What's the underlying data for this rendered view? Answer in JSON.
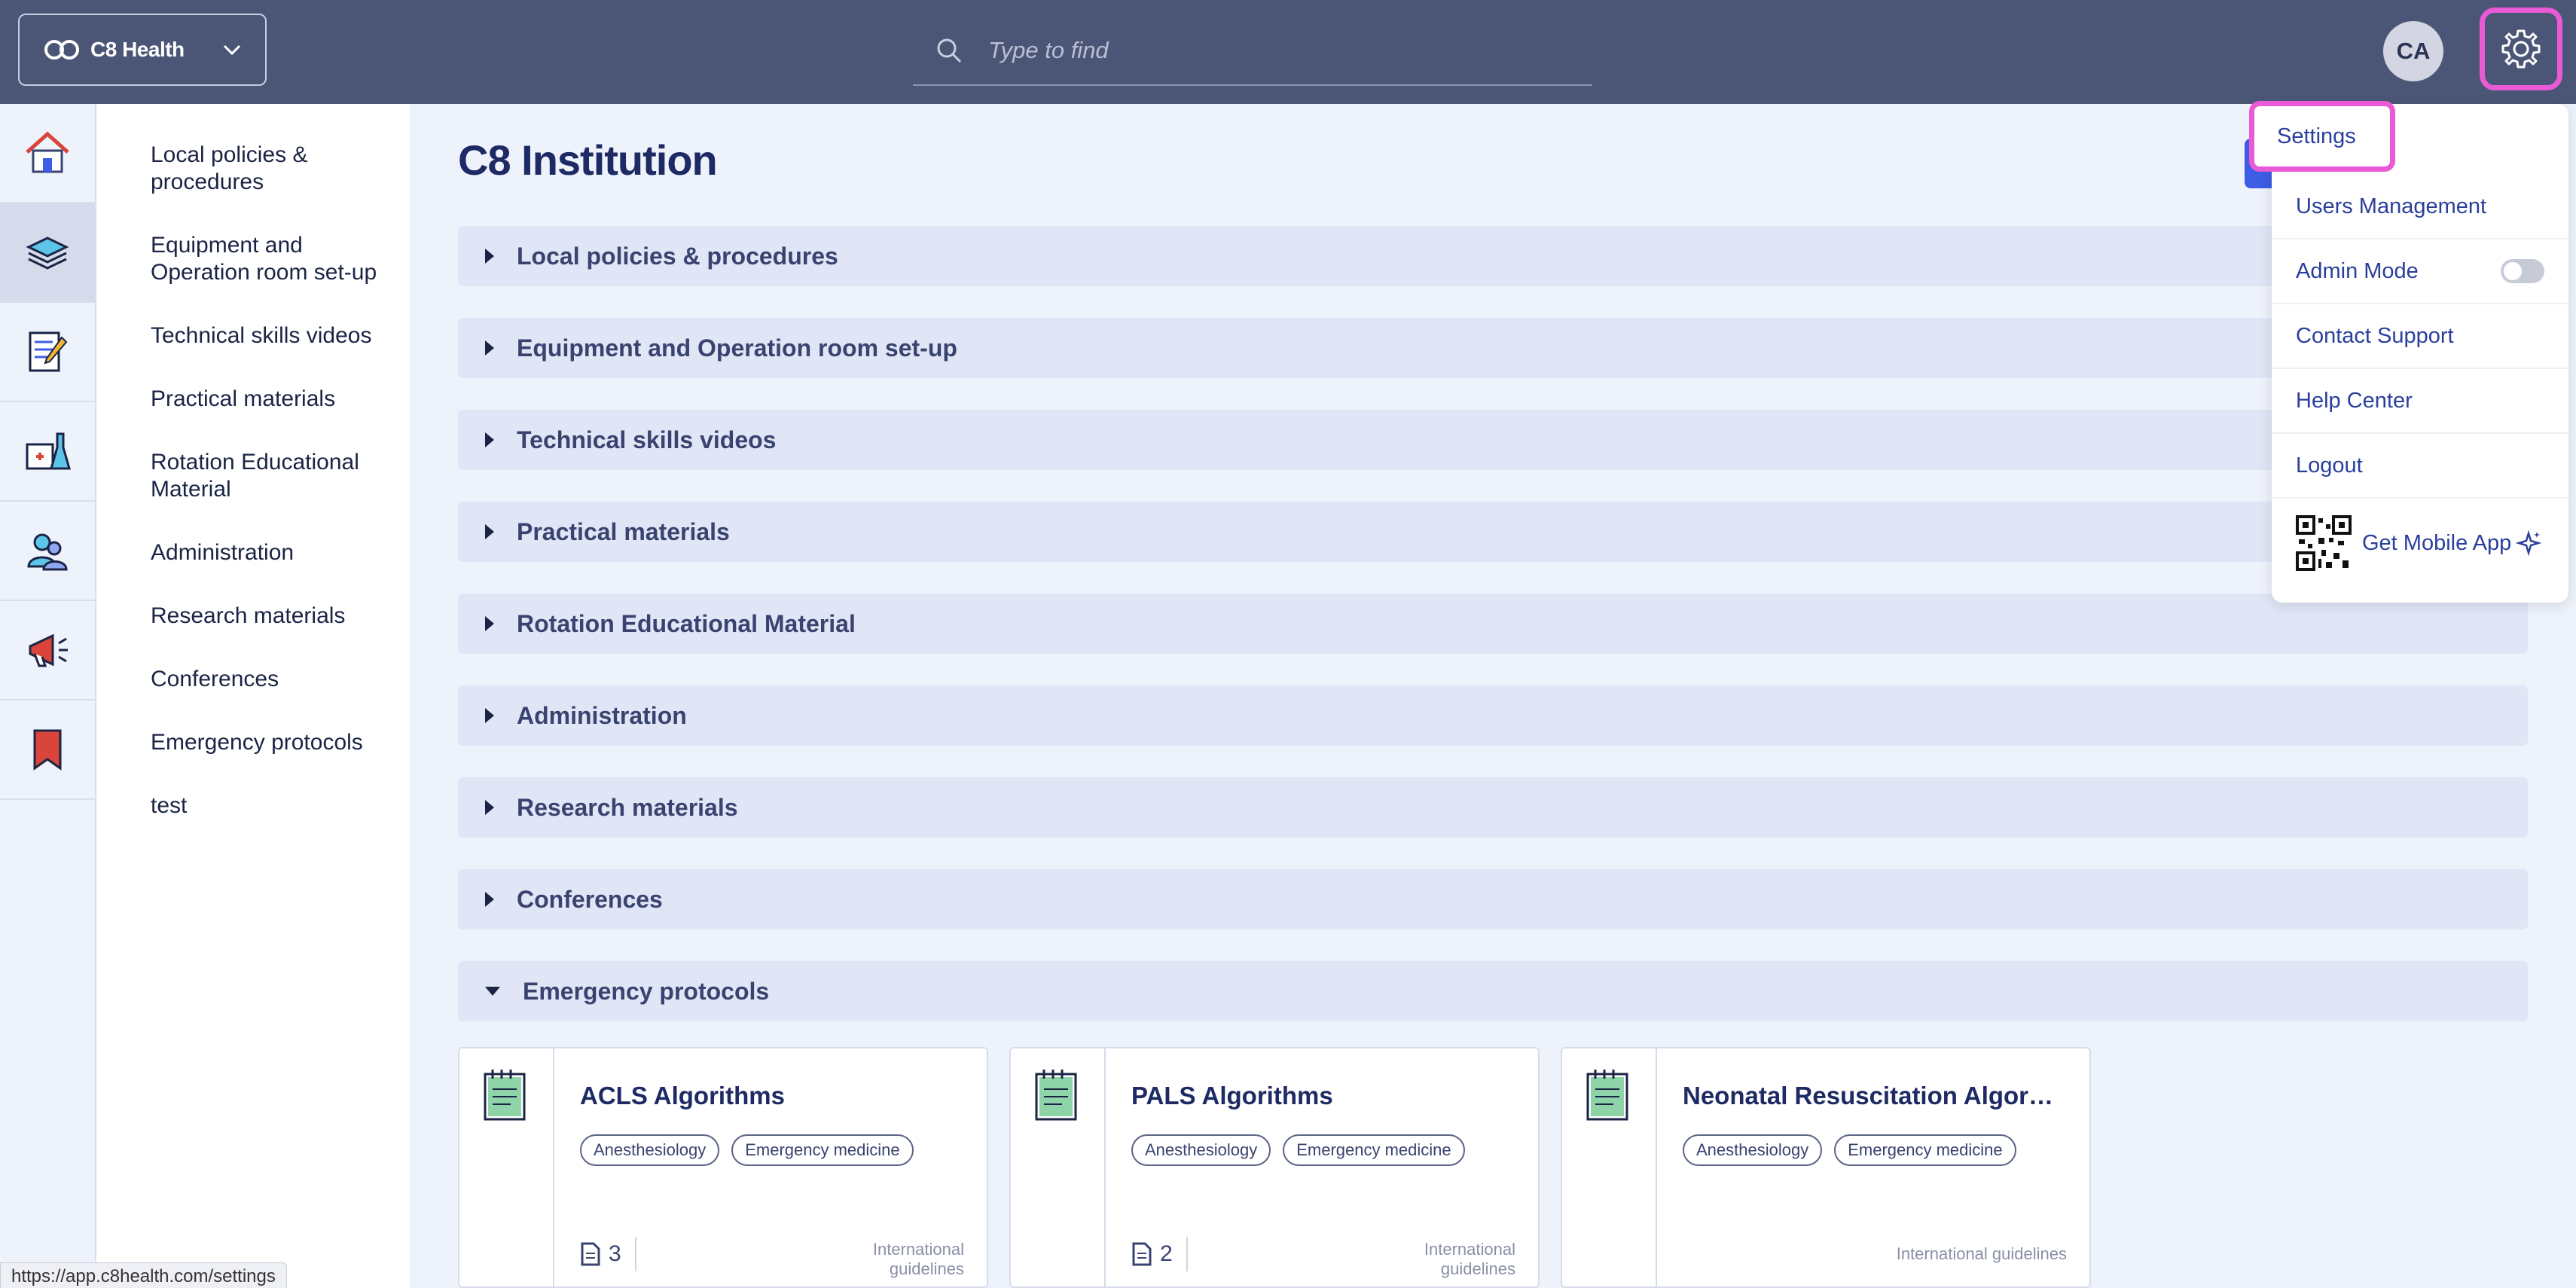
{
  "header": {
    "org_name": "C8 Health",
    "search_placeholder": "Type to find",
    "avatar_initials": "CA"
  },
  "rail": {
    "icons": [
      "home-icon",
      "library-books-icon",
      "checklist-icon",
      "lab-kit-icon",
      "people-icon",
      "megaphone-icon",
      "bookmark-icon"
    ]
  },
  "section_nav": {
    "items": [
      "Local policies & procedures",
      "Equipment and Operation room set-up",
      "Technical skills videos",
      "Practical materials",
      "Rotation Educational Material",
      "Administration",
      "Research materials",
      "Conferences",
      "Emergency protocols",
      "test"
    ]
  },
  "main": {
    "title": "C8 Institution",
    "accordions": [
      {
        "label": "Local policies & procedures",
        "open": false
      },
      {
        "label": "Equipment and Operation room set-up",
        "open": false
      },
      {
        "label": "Technical skills videos",
        "open": false
      },
      {
        "label": "Practical materials",
        "open": false
      },
      {
        "label": "Rotation Educational Material",
        "open": false
      },
      {
        "label": "Administration",
        "open": false
      },
      {
        "label": "Research materials",
        "open": false
      },
      {
        "label": "Conferences",
        "open": false
      },
      {
        "label": "Emergency protocols",
        "open": true
      }
    ],
    "cards": [
      {
        "title": "ACLS Algorithms",
        "tags": [
          "Anesthesiology",
          "Emergency medicine"
        ],
        "count": "3",
        "source": "International guidelines"
      },
      {
        "title": "PALS Algorithms",
        "tags": [
          "Anesthesiology",
          "Emergency medicine"
        ],
        "count": "2",
        "source": "International guidelines"
      },
      {
        "title": "Neonatal Resuscitation Algor…",
        "tags": [
          "Anesthesiology",
          "Emergency medicine"
        ],
        "count": "",
        "source": "International guidelines"
      }
    ]
  },
  "dropdown": {
    "settings": "Settings",
    "users_management": "Users Management",
    "admin_mode": "Admin Mode",
    "admin_mode_on": false,
    "contact_support": "Contact Support",
    "help_center": "Help Center",
    "logout": "Logout",
    "get_mobile_app": "Get Mobile App"
  },
  "status_url": "https://app.c8health.com/settings"
}
